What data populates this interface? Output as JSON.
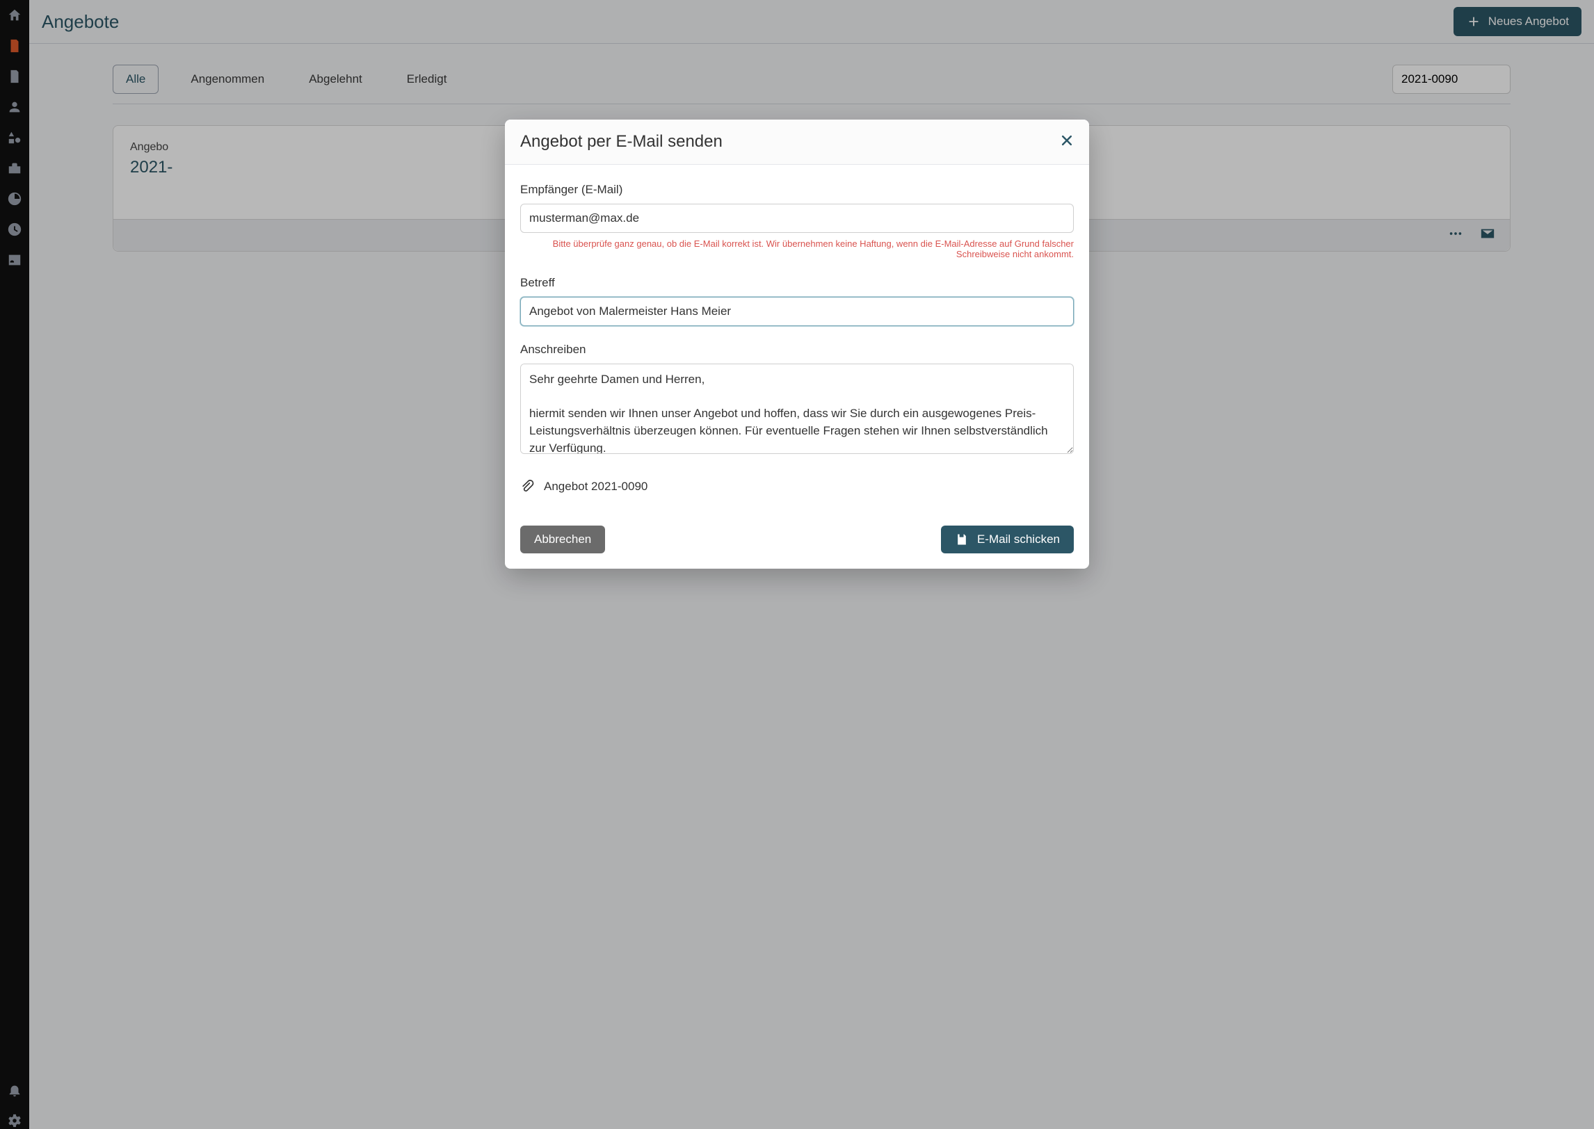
{
  "header": {
    "title": "Angebote",
    "new_button": "Neues Angebot"
  },
  "tabs": {
    "all": "Alle",
    "accepted": "Angenommen",
    "rejected": "Abgelehnt",
    "done": "Erledigt"
  },
  "search": {
    "value": "2021-0090"
  },
  "card": {
    "subtitle_prefix": "Angebo",
    "number_prefix": "2021-"
  },
  "modal": {
    "title": "Angebot per E-Mail senden",
    "recipient_label": "Empfänger (E-Mail)",
    "recipient_value": "musterman@max.de",
    "recipient_help": "Bitte überprüfe ganz genau, ob die E-Mail korrekt ist. Wir übernehmen keine Haftung, wenn die E-Mail-Adresse auf Grund falscher Schreibweise nicht ankommt.",
    "subject_label": "Betreff",
    "subject_value": "Angebot von Malermeister Hans Meier",
    "body_label": "Anschreiben",
    "body_value": "Sehr geehrte Damen und Herren,\n\nhiermit senden wir Ihnen unser Angebot und hoffen, dass wir Sie durch ein ausgewogenes Preis-Leistungsverhältnis überzeugen können. Für eventuelle Fragen stehen wir Ihnen selbstverständlich zur Verfügung.\n\nMit freundlichen Grüßen",
    "attachment_label": "Angebot 2021-0090",
    "cancel": "Abbrechen",
    "send": "E-Mail schicken"
  }
}
